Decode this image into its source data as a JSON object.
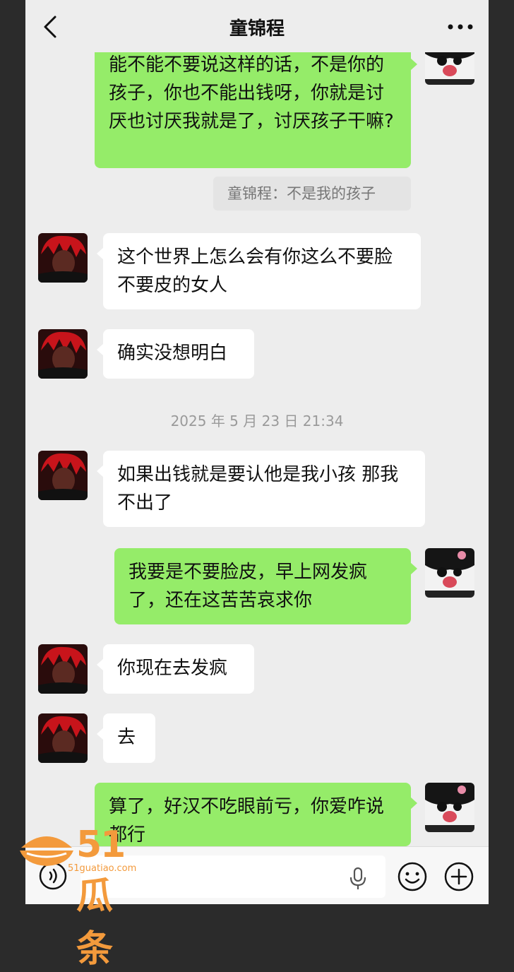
{
  "header": {
    "title": "童锦程"
  },
  "messages": {
    "m1": "能不能不要说这样的话，不是你的孩子，你也不能出钱呀，你就是讨厌也讨厌我就是了，讨厌孩子干嘛?",
    "quote": "童锦程：不是我的孩子",
    "m2": "这个世界上怎么会有你这么不要脸不要皮的女人",
    "m3": "确实没想明白",
    "timestamp": "2025 年 5 月 23 日  21:34",
    "m4": "如果出钱就是要认他是我小孩 那我不出了",
    "m5": "我要是不要脸皮，早上网发疯了，还在这苦苦哀求你",
    "m6": "你现在去发疯",
    "m7": "去",
    "m8": "算了，好汉不吃眼前亏，你爱咋说都行"
  },
  "watermark": {
    "main": "51瓜条",
    "sub": "51guatiao.com"
  },
  "colors": {
    "sent": "#95ec69",
    "received": "#ffffff",
    "background": "#ededed",
    "watermark": "#f39a3c"
  },
  "icons": [
    "back-arrow-icon",
    "more-dots-icon",
    "voice-icon",
    "microphone-icon",
    "emoji-icon",
    "plus-icon"
  ]
}
